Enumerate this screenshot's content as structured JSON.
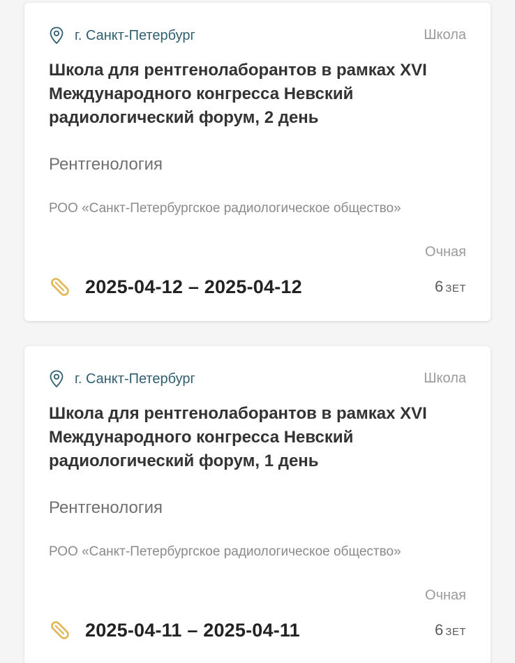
{
  "colors": {
    "location_text": "#2f5e6e",
    "clip_icon": "#e2b552",
    "card_background": "#ffffff",
    "page_background": "#f5f5f5"
  },
  "cards": [
    {
      "location": "г. Санкт-Петербург",
      "location_icon": "location-pin-icon",
      "type": "Школа",
      "title": "Школа для рентгенолаборантов в рамках XVI Международного конгресса Невский радиологический форум, 2 день",
      "specialty": "Рентгенология",
      "organization": "РОО «Санкт-Петербургское радиологическое общество»",
      "format": "Очная",
      "date_icon": "paperclip-icon",
      "dates": "2025-04-12 – 2025-04-12",
      "credits_value": "6",
      "credits_unit": "ЗЕТ"
    },
    {
      "location": "г. Санкт-Петербург",
      "location_icon": "location-pin-icon",
      "type": "Школа",
      "title": "Школа для рентгенолаборантов в рамках XVI Международного конгресса Невский радиологический форум, 1 день",
      "specialty": "Рентгенология",
      "organization": "РОО «Санкт-Петербургское радиологическое общество»",
      "format": "Очная",
      "date_icon": "paperclip-icon",
      "dates": "2025-04-11 – 2025-04-11",
      "credits_value": "6",
      "credits_unit": "ЗЕТ"
    }
  ]
}
